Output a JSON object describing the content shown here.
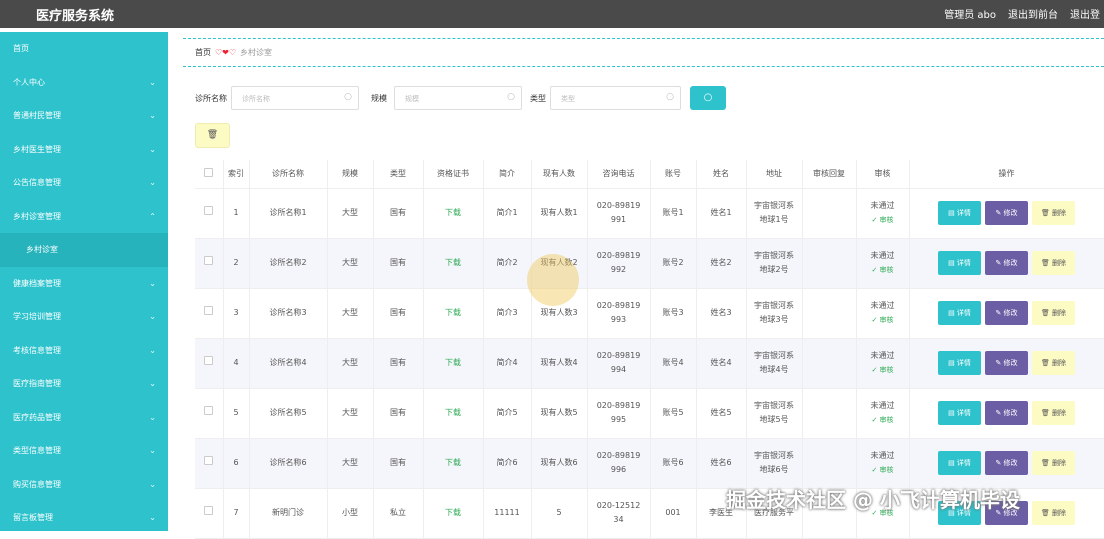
{
  "app": {
    "title": "医疗服务系统",
    "user_label": "管理员 abo",
    "goto_front": "退出到前台",
    "logout": "退出登"
  },
  "sidebar": {
    "items": [
      {
        "label": "首页",
        "chevron": ""
      },
      {
        "label": "个人中心",
        "chevron": "⌄"
      },
      {
        "label": "普通村民管理",
        "chevron": "⌄"
      },
      {
        "label": "乡村医生管理",
        "chevron": "⌄"
      },
      {
        "label": "公告信息管理",
        "chevron": "⌄"
      },
      {
        "label": "乡村诊室管理",
        "chevron": "⌃"
      },
      {
        "label": "乡村诊室",
        "chevron": ""
      },
      {
        "label": "健康档案管理",
        "chevron": "⌄"
      },
      {
        "label": "学习培训管理",
        "chevron": "⌄"
      },
      {
        "label": "考核信息管理",
        "chevron": "⌄"
      },
      {
        "label": "医疗指南管理",
        "chevron": "⌄"
      },
      {
        "label": "医疗药品管理",
        "chevron": "⌄"
      },
      {
        "label": "类型信息管理",
        "chevron": "⌄"
      },
      {
        "label": "购买信息管理",
        "chevron": "⌄"
      },
      {
        "label": "留言板管理",
        "chevron": "⌄"
      }
    ]
  },
  "breadcrumb": {
    "home": "首页",
    "sep": "♡❤♡",
    "current": "乡村诊室"
  },
  "search": {
    "name_label": "诊所名称",
    "name_placeholder": "诊所名称",
    "scale_label": "规模",
    "scale_placeholder": "规模",
    "type_label": "类型",
    "type_placeholder": "类型",
    "button_icon": "search-icon"
  },
  "toolbar": {
    "delete_icon": "🗑"
  },
  "table": {
    "headers": [
      "",
      "索引",
      "诊所名称",
      "规模",
      "类型",
      "资格证书",
      "简介",
      "现有人数",
      "咨询电话",
      "账号",
      "姓名",
      "地址",
      "审核回复",
      "审核",
      "操作"
    ],
    "rows": [
      {
        "index": "1",
        "name": "诊所名称1",
        "scale": "大型",
        "type": "国有",
        "cert": "下载",
        "intro": "简介1",
        "count": "现有人数1",
        "phone1": "020-89819",
        "phone2": "991",
        "account": "账号1",
        "person": "姓名1",
        "addr1": "宇宙银河系",
        "addr2": "地球1号",
        "reply": "",
        "status": "未通过",
        "audit": "✓ 审核"
      },
      {
        "index": "2",
        "name": "诊所名称2",
        "scale": "大型",
        "type": "国有",
        "cert": "下载",
        "intro": "简介2",
        "count": "现有人数2",
        "phone1": "020-89819",
        "phone2": "992",
        "account": "账号2",
        "person": "姓名2",
        "addr1": "宇宙银河系",
        "addr2": "地球2号",
        "reply": "",
        "status": "未通过",
        "audit": "✓ 审核"
      },
      {
        "index": "3",
        "name": "诊所名称3",
        "scale": "大型",
        "type": "国有",
        "cert": "下载",
        "intro": "简介3",
        "count": "现有人数3",
        "phone1": "020-89819",
        "phone2": "993",
        "account": "账号3",
        "person": "姓名3",
        "addr1": "宇宙银河系",
        "addr2": "地球3号",
        "reply": "",
        "status": "未通过",
        "audit": "✓ 审核"
      },
      {
        "index": "4",
        "name": "诊所名称4",
        "scale": "大型",
        "type": "国有",
        "cert": "下载",
        "intro": "简介4",
        "count": "现有人数4",
        "phone1": "020-89819",
        "phone2": "994",
        "account": "账号4",
        "person": "姓名4",
        "addr1": "宇宙银河系",
        "addr2": "地球4号",
        "reply": "",
        "status": "未通过",
        "audit": "✓ 审核"
      },
      {
        "index": "5",
        "name": "诊所名称5",
        "scale": "大型",
        "type": "国有",
        "cert": "下载",
        "intro": "简介5",
        "count": "现有人数5",
        "phone1": "020-89819",
        "phone2": "995",
        "account": "账号5",
        "person": "姓名5",
        "addr1": "宇宙银河系",
        "addr2": "地球5号",
        "reply": "",
        "status": "未通过",
        "audit": "✓ 审核"
      },
      {
        "index": "6",
        "name": "诊所名称6",
        "scale": "大型",
        "type": "国有",
        "cert": "下载",
        "intro": "简介6",
        "count": "现有人数6",
        "phone1": "020-89819",
        "phone2": "996",
        "account": "账号6",
        "person": "姓名6",
        "addr1": "宇宙银河系",
        "addr2": "地球6号",
        "reply": "",
        "status": "未通过",
        "audit": "✓ 审核"
      },
      {
        "index": "7",
        "name": "新明门诊",
        "scale": "小型",
        "type": "私立",
        "cert": "下载",
        "intro": "11111",
        "count": "5",
        "phone1": "020-12512",
        "phone2": "34",
        "account": "001",
        "person": "李医生",
        "addr1": "医疗服务平",
        "addr2": "",
        "reply": "",
        "status": "",
        "audit": "✓ 审核"
      }
    ],
    "actions": {
      "detail": "▤ 详情",
      "edit": "✎ 修改",
      "delete": "🗑 删除"
    }
  },
  "watermark": "掘金技术社区 @ 小飞计算机毕设",
  "colors": {
    "accent": "#2ec3cc",
    "edit": "#6b5ea5",
    "delete": "#fdfbc4",
    "topbar": "#4a4a4a"
  }
}
